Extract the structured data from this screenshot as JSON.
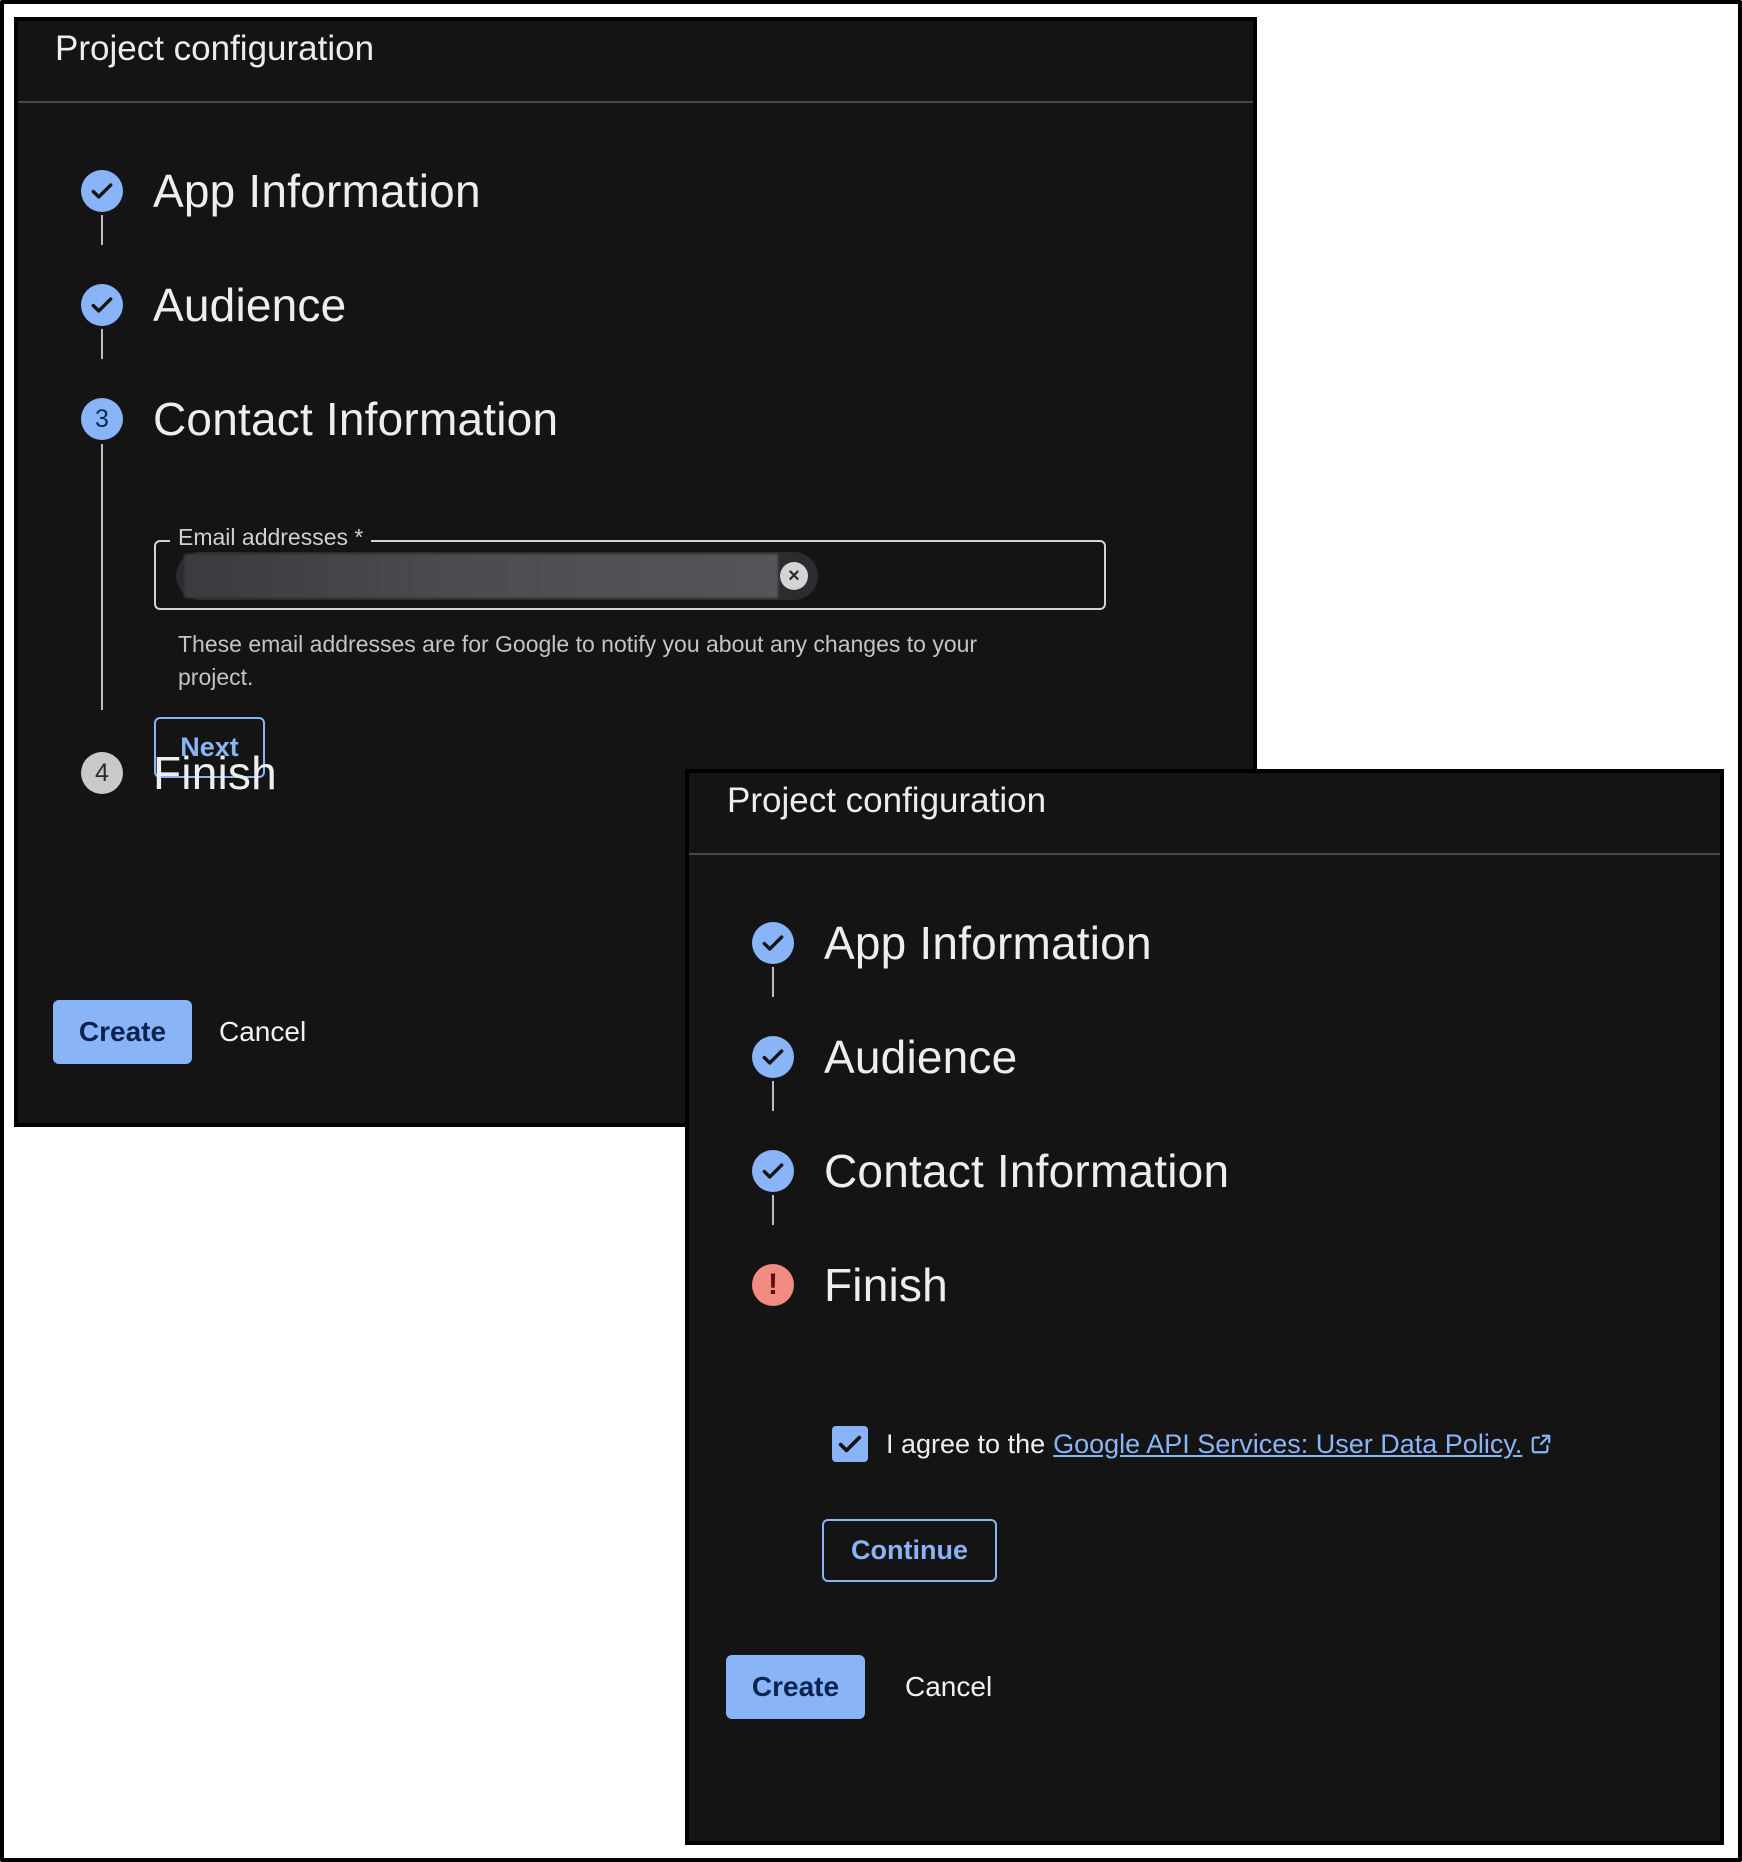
{
  "panel_left": {
    "header_title": "Project configuration",
    "steps": [
      {
        "title": "App Information",
        "state": "complete"
      },
      {
        "title": "Audience",
        "state": "complete"
      },
      {
        "title": "Contact Information",
        "state": "active",
        "number": "3"
      },
      {
        "title": "Finish",
        "state": "pending",
        "number": "4"
      }
    ],
    "email_field": {
      "label": "Email addresses *",
      "hint": "These email addresses are for Google to notify you about any changes to your project."
    },
    "next_label": "Next",
    "create_label": "Create",
    "cancel_label": "Cancel"
  },
  "panel_right": {
    "header_title": "Project configuration",
    "steps": [
      {
        "title": "App Information",
        "state": "complete"
      },
      {
        "title": "Audience",
        "state": "complete"
      },
      {
        "title": "Contact Information",
        "state": "complete"
      },
      {
        "title": "Finish",
        "state": "error",
        "error_symbol": "!"
      }
    ],
    "agreement": {
      "prefix": "I agree to the",
      "link_text": "Google API Services: User Data Policy.",
      "checked": true
    },
    "continue_label": "Continue",
    "create_label": "Create",
    "cancel_label": "Cancel"
  },
  "colors": {
    "panel_bg": "#141415",
    "accent": "#8ab4f8",
    "error": "#f28b82",
    "pending": "#c9c9cb"
  },
  "icons": [
    "check-circle-icon",
    "step-number-icon",
    "error-icon",
    "clear-icon",
    "checkbox-checked-icon",
    "external-link-icon"
  ]
}
